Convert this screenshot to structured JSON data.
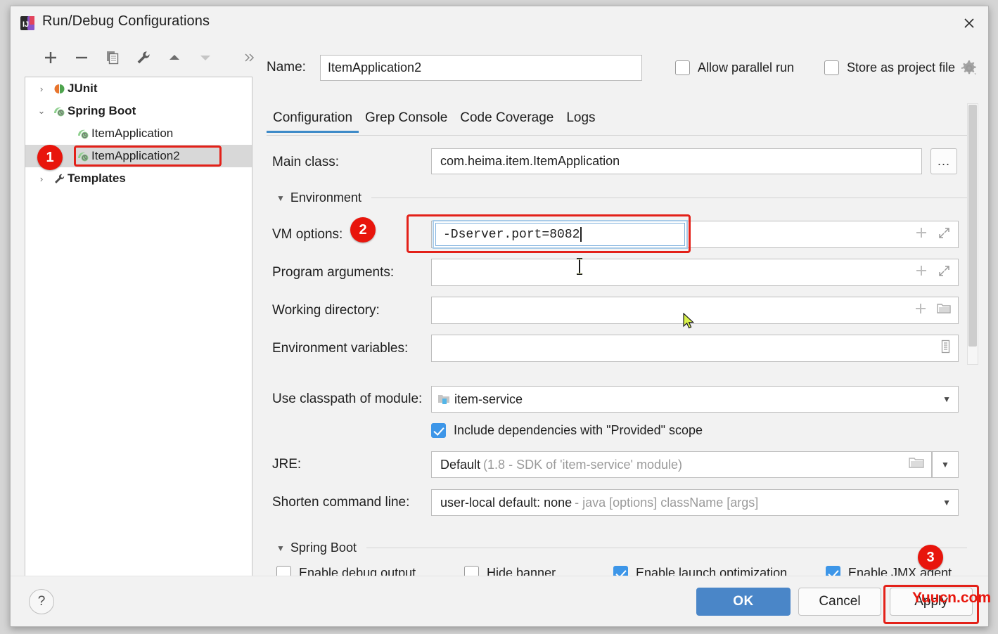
{
  "window": {
    "title": "Run/Debug Configurations",
    "app_icon": "intellij-idea-icon",
    "close_icon": "close-icon"
  },
  "toolbar": {
    "buttons": [
      {
        "name": "add-configuration-button",
        "icon": "plus-icon",
        "glyph": "+"
      },
      {
        "name": "remove-configuration-button",
        "icon": "minus-icon",
        "glyph": "−"
      },
      {
        "name": "copy-configuration-button",
        "icon": "copy-icon",
        "glyph": "⧉"
      },
      {
        "name": "edit-templates-button",
        "icon": "wrench-icon",
        "glyph": "🔧"
      },
      {
        "name": "move-up-button",
        "icon": "triangle-up-icon",
        "glyph": "▲"
      },
      {
        "name": "move-down-button",
        "icon": "triangle-down-icon",
        "glyph": "▼"
      },
      {
        "name": "more-options-button",
        "icon": "chevron-double-right-icon",
        "glyph": "»"
      }
    ]
  },
  "tree": {
    "items": [
      {
        "label": "JUnit",
        "arrow": "›",
        "icon": "junit-icon",
        "bold": true,
        "indent": 0,
        "selected": false
      },
      {
        "label": "Spring Boot",
        "arrow": "⌄",
        "icon": "spring-boot-icon",
        "bold": true,
        "indent": 0,
        "selected": false
      },
      {
        "label": "ItemApplication",
        "arrow": "",
        "icon": "spring-boot-icon",
        "bold": false,
        "indent": 1,
        "selected": false
      },
      {
        "label": "ItemApplication2",
        "arrow": "",
        "icon": "spring-boot-icon",
        "bold": false,
        "indent": 1,
        "selected": true
      },
      {
        "label": "Templates",
        "arrow": "›",
        "icon": "wrench-icon",
        "bold": true,
        "indent": 0,
        "selected": false
      }
    ]
  },
  "badges": [
    {
      "number": "1"
    },
    {
      "number": "2"
    },
    {
      "number": "3"
    }
  ],
  "header": {
    "name_label": "Name:",
    "name_value": "ItemApplication2",
    "name_placeholder": "",
    "allow_parallel_run_label": "Allow parallel run",
    "allow_parallel_run_checked": false,
    "store_as_project_file_label": "Store as project file",
    "store_as_project_file_checked": false,
    "gear_icon": "gear-icon"
  },
  "tabs": [
    {
      "label": "Configuration",
      "active": true
    },
    {
      "label": "Grep Console",
      "active": false
    },
    {
      "label": "Code Coverage",
      "active": false
    },
    {
      "label": "Logs",
      "active": false
    }
  ],
  "form": {
    "main_class_label": "Main class:",
    "main_class_value": "com.heima.item.ItemApplication",
    "main_class_placeholder": "",
    "browse_button_label": "...",
    "environment_section_label": "Environment",
    "vm_options_label": "VM options:",
    "vm_options_value": "-Dserver.port=8082",
    "vm_options_placeholder": "",
    "program_arguments_label": "Program arguments:",
    "program_arguments_value": "",
    "working_directory_label": "Working directory:",
    "working_directory_value": "",
    "environment_variables_label": "Environment variables:",
    "environment_variables_value": "",
    "use_classpath_label": "Use classpath of module:",
    "use_classpath_value": "item-service",
    "include_dependencies_label": "Include dependencies with \"Provided\" scope",
    "include_dependencies_checked": true,
    "jre_label": "JRE:",
    "jre_value": "Default",
    "jre_value_sub": "(1.8 - SDK of 'item-service' module)",
    "shorten_command_line_label": "Shorten command line:",
    "shorten_command_line_value": "user-local default: none",
    "shorten_command_line_sub": "- java [options] className [args]",
    "spring_boot_section_label": "Spring Boot",
    "spring_boot_checkboxes": [
      {
        "label": "Enable debug output",
        "checked": false
      },
      {
        "label": "Hide banner",
        "checked": false
      },
      {
        "label": "Enable launch optimization",
        "checked": true
      },
      {
        "label": "Enable JMX agent",
        "checked": true
      }
    ],
    "expand_icon": "expand-diagonal-icon",
    "add_icon": "plus-icon",
    "folder_icon": "folder-icon",
    "list_icon": "list-icon"
  },
  "footer": {
    "help_label": "?",
    "ok_label": "OK",
    "cancel_label": "Cancel",
    "apply_label": "Apply"
  },
  "watermark": {
    "text": "Yuucn.com"
  },
  "colors": {
    "accent_blue": "#4a86c8",
    "highlight_red": "#e32119",
    "badge_red": "#e8150c",
    "checkbox_blue": "#3d96e8",
    "tab_underline": "#3d8ac8",
    "selection_gray": "#d8d8d8"
  }
}
